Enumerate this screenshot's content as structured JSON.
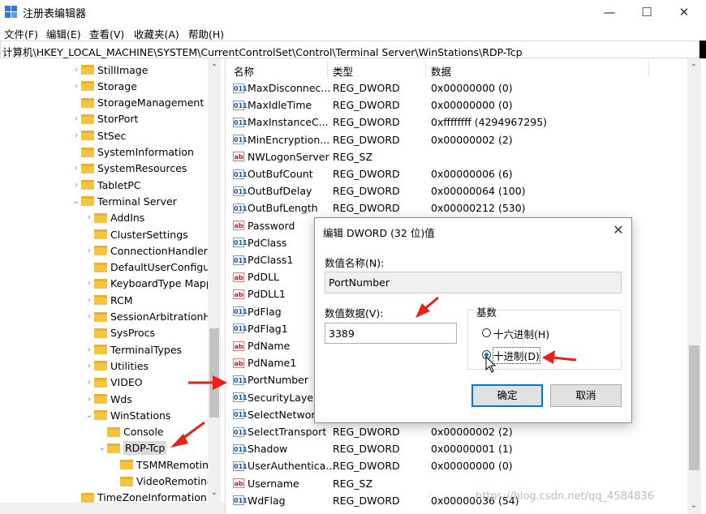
{
  "window": {
    "title": "注册表编辑器",
    "minimize": "—",
    "maximize": "☐",
    "close": "✕"
  },
  "menu": [
    "文件(F)",
    "编辑(E)",
    "查看(V)",
    "收藏夹(A)",
    "帮助(H)"
  ],
  "address": "计算机\\HKEY_LOCAL_MACHINE\\SYSTEM\\CurrentControlSet\\Control\\Terminal Server\\WinStations\\RDP-Tcp",
  "tree": [
    {
      "label": "StillImage",
      "level": 1,
      "expander": "›"
    },
    {
      "label": "Storage",
      "level": 1,
      "expander": "›"
    },
    {
      "label": "StorageManagement",
      "level": 1,
      "expander": ""
    },
    {
      "label": "StorPort",
      "level": 1,
      "expander": "›"
    },
    {
      "label": "StSec",
      "level": 1,
      "expander": "›"
    },
    {
      "label": "SystemInformation",
      "level": 1,
      "expander": ""
    },
    {
      "label": "SystemResources",
      "level": 1,
      "expander": "›"
    },
    {
      "label": "TabletPC",
      "level": 1,
      "expander": "›"
    },
    {
      "label": "Terminal Server",
      "level": 1,
      "expander": "⌄"
    },
    {
      "label": "AddIns",
      "level": 2,
      "expander": "›"
    },
    {
      "label": "ClusterSettings",
      "level": 2,
      "expander": ""
    },
    {
      "label": "ConnectionHandler",
      "level": 2,
      "expander": "›"
    },
    {
      "label": "DefaultUserConfigur",
      "level": 2,
      "expander": ""
    },
    {
      "label": "KeyboardType Mapp",
      "level": 2,
      "expander": "›"
    },
    {
      "label": "RCM",
      "level": 2,
      "expander": "›"
    },
    {
      "label": "SessionArbitrationHe",
      "level": 2,
      "expander": "›"
    },
    {
      "label": "SysProcs",
      "level": 2,
      "expander": ""
    },
    {
      "label": "TerminalTypes",
      "level": 2,
      "expander": "›"
    },
    {
      "label": "Utilities",
      "level": 2,
      "expander": "›"
    },
    {
      "label": "VIDEO",
      "level": 2,
      "expander": "›"
    },
    {
      "label": "Wds",
      "level": 2,
      "expander": "›"
    },
    {
      "label": "WinStations",
      "level": 2,
      "expander": "⌄"
    },
    {
      "label": "Console",
      "level": 3,
      "expander": ""
    },
    {
      "label": "RDP-Tcp",
      "level": 3,
      "expander": "⌄",
      "selected": true
    },
    {
      "label": "TSMMRemotin",
      "level": 4,
      "expander": ""
    },
    {
      "label": "VideoRemoting",
      "level": 4,
      "expander": ""
    },
    {
      "label": "TimeZoneInformation",
      "level": 1,
      "expander": ""
    }
  ],
  "columns": {
    "name": "名称",
    "type": "类型",
    "data": "数据"
  },
  "values": [
    {
      "name": "MaxDisconnec...",
      "type": "REG_DWORD",
      "data": "0x00000000 (0)",
      "icon": "011"
    },
    {
      "name": "MaxIdleTime",
      "type": "REG_DWORD",
      "data": "0x00000000 (0)",
      "icon": "011"
    },
    {
      "name": "MaxInstanceC...",
      "type": "REG_DWORD",
      "data": "0xffffffff (4294967295)",
      "icon": "011"
    },
    {
      "name": "MinEncryption...",
      "type": "REG_DWORD",
      "data": "0x00000002 (2)",
      "icon": "011"
    },
    {
      "name": "NWLogonServer",
      "type": "REG_SZ",
      "data": "",
      "icon": "ab"
    },
    {
      "name": "OutBufCount",
      "type": "REG_DWORD",
      "data": "0x00000006 (6)",
      "icon": "011"
    },
    {
      "name": "OutBufDelay",
      "type": "REG_DWORD",
      "data": "0x00000064 (100)",
      "icon": "011"
    },
    {
      "name": "OutBufLength",
      "type": "REG_DWORD",
      "data": "0x00000212 (530)",
      "icon": "011"
    },
    {
      "name": "Password",
      "type": "",
      "data": "",
      "icon": "ab"
    },
    {
      "name": "PdClass",
      "type": "",
      "data": "",
      "icon": "011"
    },
    {
      "name": "PdClass1",
      "type": "",
      "data": "",
      "icon": "011"
    },
    {
      "name": "PdDLL",
      "type": "",
      "data": "",
      "icon": "ab"
    },
    {
      "name": "PdDLL1",
      "type": "",
      "data": "",
      "icon": "ab"
    },
    {
      "name": "PdFlag",
      "type": "",
      "data": "",
      "icon": "011"
    },
    {
      "name": "PdFlag1",
      "type": "",
      "data": "",
      "icon": "011"
    },
    {
      "name": "PdName",
      "type": "",
      "data": "",
      "icon": "ab"
    },
    {
      "name": "PdName1",
      "type": "",
      "data": "",
      "icon": "ab"
    },
    {
      "name": "PortNumber",
      "type": "",
      "data": "",
      "icon": "011"
    },
    {
      "name": "SecurityLayer",
      "type": "",
      "data": "",
      "icon": "011"
    },
    {
      "name": "SelectNetwork",
      "type": "REG_DWORD",
      "data": "",
      "icon": "011"
    },
    {
      "name": "SelectTransport",
      "type": "REG_DWORD",
      "data": "0x00000002 (2)",
      "icon": "011"
    },
    {
      "name": "Shadow",
      "type": "REG_DWORD",
      "data": "0x00000001 (1)",
      "icon": "011"
    },
    {
      "name": "UserAuthentica...",
      "type": "REG_DWORD",
      "data": "0x00000000 (0)",
      "icon": "011"
    },
    {
      "name": "Username",
      "type": "REG_SZ",
      "data": "",
      "icon": "ab"
    },
    {
      "name": "WdFlag",
      "type": "REG_DWORD",
      "data": "0x00000036 (54)",
      "icon": "011"
    }
  ],
  "dialog": {
    "title": "编辑 DWORD (32 位)值",
    "close": "✕",
    "name_label": "数值名称(N):",
    "name_value": "PortNumber",
    "data_label": "数值数据(V):",
    "data_value": "3389",
    "base_label": "基数",
    "hex_label": "十六进制(H)",
    "dec_label": "十进制(D)",
    "selected_base": "dec",
    "ok": "确定",
    "cancel": "取消"
  },
  "watermark": "https://blog.csdn.net/qq_4584836",
  "accent_color": "#0078d7",
  "annotation_color": "#e8221b"
}
